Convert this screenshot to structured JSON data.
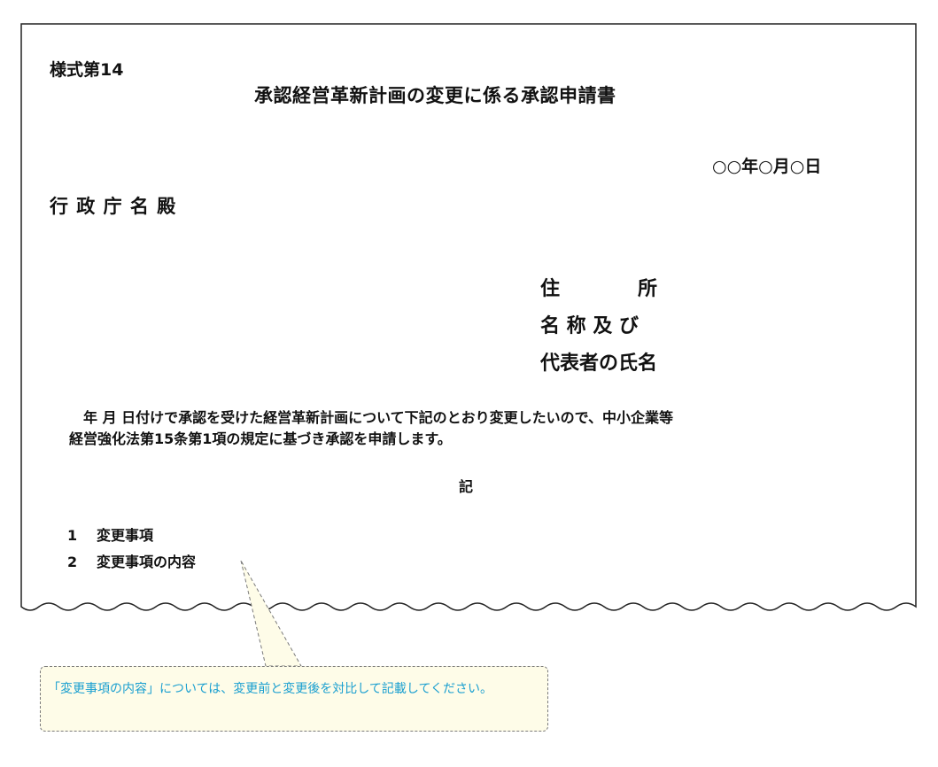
{
  "form": {
    "number": "様式第14",
    "title": "承認経営革新計画の変更に係る承認申請書",
    "date": "○○年○月○日",
    "addressee": "行 政 庁 名 殿",
    "applicant": {
      "address": "住　　　　所",
      "name": "名 称 及 び",
      "representative": "代表者の氏名"
    },
    "body": {
      "line1": "年 月 日付けで承認を受けた経営革新計画について下記のとおり変更したいので、中小企業等",
      "line2": "経営強化法第15条第1項の規定に基づき承認を申請します。"
    },
    "ki": "記",
    "items": [
      {
        "num": "1",
        "label": "変更事項"
      },
      {
        "num": "2",
        "label": "変更事項の内容"
      }
    ]
  },
  "note": {
    "text": "「変更事項の内容」については、変更前と変更後を対比して記載してください。"
  },
  "colors": {
    "note_text": "#1a9fd0",
    "note_background": "#fefce8",
    "border": "#222222"
  }
}
